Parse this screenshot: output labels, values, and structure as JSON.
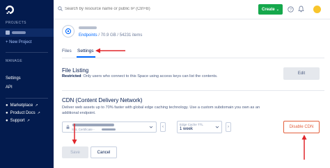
{
  "sidebar": {
    "projects_label": "PROJECTS",
    "new_project": "+ New Project",
    "manage_label": "MANAGE",
    "items": [
      {
        "label": "Settings"
      },
      {
        "label": "API"
      }
    ],
    "links": [
      {
        "label": "Marketplace",
        "icon": "external-link-icon"
      },
      {
        "label": "Product Docs",
        "icon": "external-link-icon"
      },
      {
        "label": "Support",
        "icon": "external-link-icon"
      }
    ]
  },
  "topbar": {
    "search_placeholder": "Search by resource name or public IP (Ctrl+B)",
    "create_label": "Create"
  },
  "space": {
    "meta_link": "Endpoints",
    "meta_text": " / 70.9 GB / 54231 items"
  },
  "tabs": [
    {
      "label": "Files",
      "active": false
    },
    {
      "label": "Settings",
      "active": true
    }
  ],
  "file_listing": {
    "title": "File Listing",
    "restricted_label": "Restricted",
    "restricted_text": ": Only users who connect to this Space using access keys can list the contents.",
    "edit_label": "Edit"
  },
  "cdn": {
    "title": "CDN (Content Delivery Network)",
    "description_1": "Deliver web assets up to 70% faster with global edge caching technology. Use a custom subdomain you own as an",
    "description_2": "additional endpoint.",
    "endpoint_sub": "SSL Certificate -",
    "ttl_label": "Edge Cache TTL",
    "ttl_value": "1 week",
    "disable_label": "Disable CDN",
    "save_label": "Save",
    "cancel_label": "Cancel"
  },
  "colors": {
    "sidebar_bg": "#031b4e",
    "accent": "#0069ff",
    "create_green": "#15a84c",
    "danger": "#e35f3c",
    "annotation_red": "#e0262a"
  }
}
